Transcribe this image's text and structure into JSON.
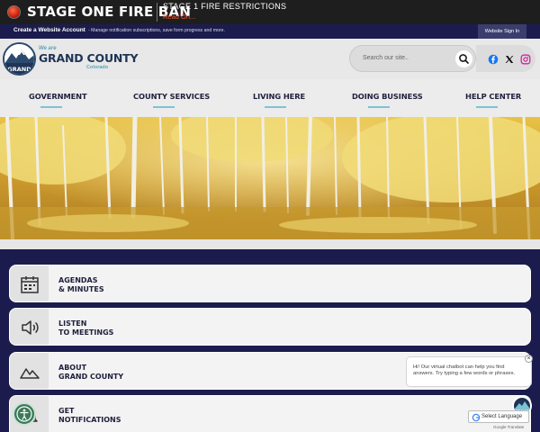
{
  "alert": {
    "title": "STAGE ONE FIRE BAN",
    "message": "STAGE 1 FIRE RESTRICTIONS",
    "link": "Read On..."
  },
  "account_bar": {
    "create_link": "Create a Website Account",
    "description": "- Manage notification subscriptions, save form progress and more.",
    "sign_in": "Website Sign In"
  },
  "logo": {
    "badge_text": "GRAND",
    "we_are": "We are",
    "name": "GRAND COUNTY",
    "state": "Colorado"
  },
  "search": {
    "placeholder": "Search our site..",
    "icon": "search-icon"
  },
  "socials": [
    {
      "name": "facebook-icon",
      "color": "#1877f2"
    },
    {
      "name": "x-icon",
      "color": "#111111"
    },
    {
      "name": "instagram-icon",
      "color": "#d6249f"
    }
  ],
  "nav": {
    "items": [
      "GOVERNMENT",
      "COUNTY SERVICES",
      "LIVING HERE",
      "DOING BUSINESS",
      "HELP CENTER"
    ],
    "accent": "#7cc3d4"
  },
  "quicklinks": [
    {
      "line1": "AGENDAS",
      "line2": "& MINUTES",
      "icon": "calendar-icon"
    },
    {
      "line1": "LISTEN",
      "line2": "TO MEETINGS",
      "icon": "speaker-icon"
    },
    {
      "line1": "ABOUT",
      "line2": "GRAND COUNTY",
      "icon": "mountain-icon"
    },
    {
      "line1": "GET",
      "line2": "NOTIFICATIONS",
      "icon": "bell-icon"
    }
  ],
  "chatbot": {
    "message": "Hi! Our virtual chatbot can help you find answers. Try typing a few words or phrases.",
    "close": "×",
    "avatar_text": "GRAND"
  },
  "translate": {
    "label": "Select Language",
    "powered": "Google Translate"
  },
  "colors": {
    "navy": "#1b1c4d",
    "alert_red": "#ef5a3a",
    "brand_teal": "#5ba3b8",
    "brand_navy": "#1f3456"
  }
}
